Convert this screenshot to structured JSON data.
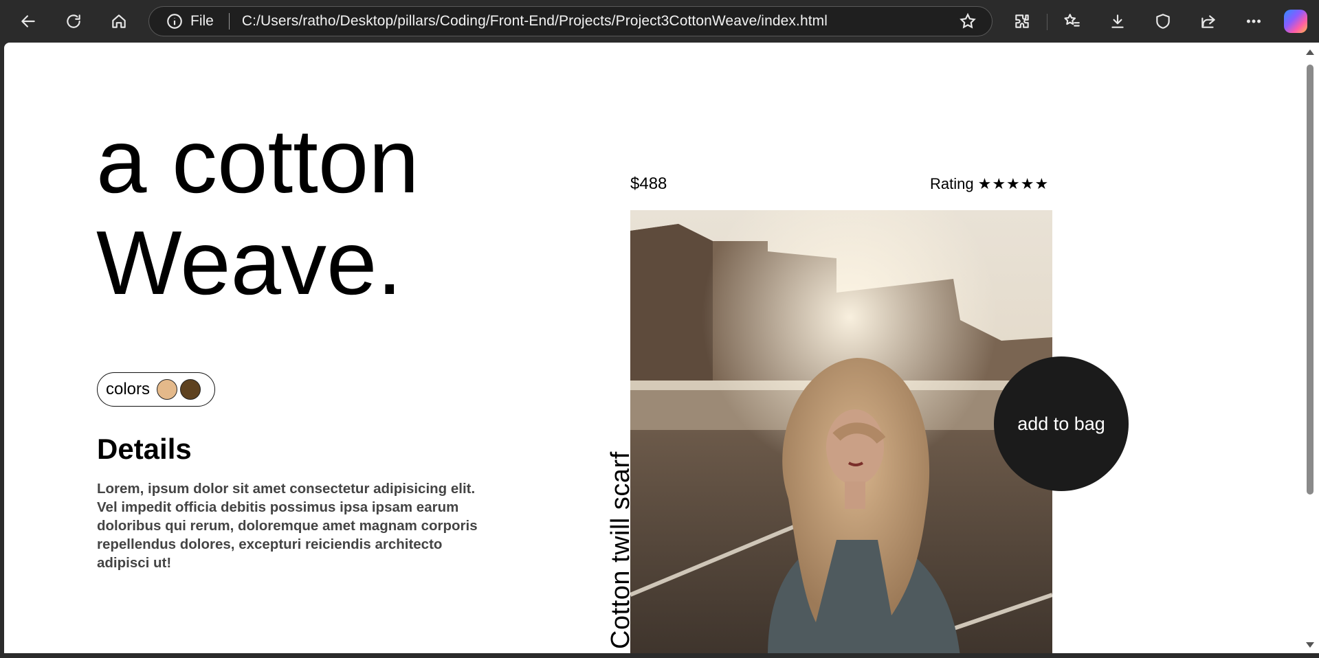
{
  "browser": {
    "address_prefix": "File",
    "url": "C:/Users/ratho/Desktop/pillars/Coding/Front-End/Projects/Project3CottonWeave/index.html"
  },
  "page": {
    "title_line1": "a cotton",
    "title_line2": "Weave.",
    "colors_label": "colors",
    "swatches": [
      "#e4b98a",
      "#5e4220"
    ],
    "details_heading": "Details",
    "details_text": "Lorem, ipsum dolor sit amet consectetur adipisicing elit. Vel impedit officia debitis possimus ipsa ipsam earum doloribus qui rerum, doloremque amet magnam corporis repellendus dolores, excepturi reiciendis architecto adipisci ut!",
    "price": "$488",
    "rating_label": "Rating",
    "rating_stars": "★★★★★",
    "product_name": "Cotton twill scarf",
    "add_to_bag": "add to bag"
  }
}
